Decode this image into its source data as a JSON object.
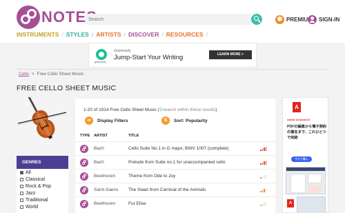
{
  "header": {
    "logo_text": "NOTES",
    "search_placeholder": "Search",
    "premium_label": "PREMIUM",
    "signin_label": "SIGN-IN"
  },
  "nav": {
    "items": [
      {
        "label": "INSTRUMENTS",
        "color": "#c9a227"
      },
      {
        "label": "STYLES",
        "color": "#2fae9b"
      },
      {
        "label": "ARTISTS",
        "color": "#e9732b"
      },
      {
        "label": "DISCOVER",
        "color": "#a64f94"
      },
      {
        "label": "RESOURCES",
        "color": "#e9732b"
      }
    ],
    "separator": "/"
  },
  "ad_banner": {
    "brand": "Grammarly",
    "brand_sub": "grammarly",
    "headline": "Jump-Start Your Writing",
    "cta": "LEARN MORE >"
  },
  "breadcrumb": {
    "link": "Cello",
    "separator": ">",
    "current": "Free Cello Sheet Music"
  },
  "page_title": "FREE CELLO SHEET MUSIC",
  "genres": {
    "heading": "GENRES",
    "items": [
      {
        "label": "All",
        "checked": true
      },
      {
        "label": "Classical",
        "checked": false
      },
      {
        "label": "Rock & Pop",
        "checked": false
      },
      {
        "label": "Jazz",
        "checked": false
      },
      {
        "label": "Traditional",
        "checked": false
      },
      {
        "label": "World",
        "checked": false
      }
    ]
  },
  "results": {
    "summary": "1-20 of 1914 Free Cello Sheet Music",
    "open_paren": " (",
    "search_within": "search within these results",
    "close_paren": ")",
    "display_filters": "Display Filters",
    "sort": "Sort: Popularity"
  },
  "table": {
    "headers": {
      "type": "TYPE",
      "artist": "ARTIST",
      "title": "TITLE"
    },
    "rows": [
      {
        "artist": "Bach",
        "title": "Cello Suite No.1 in G major, BWV 1007 (complete)",
        "difficulty_color": "#e0453a",
        "difficulty_level": 4
      },
      {
        "artist": "Bach",
        "title": "Prelude from Suite no.1 for unaccompanied cello",
        "difficulty_color": "#e0453a",
        "difficulty_level": 4
      },
      {
        "artist": "Beethoven",
        "title": "Theme from Ode to Joy",
        "difficulty_color": "#6cc04a",
        "difficulty_level": 1
      },
      {
        "artist": "Saint-Saens",
        "title": "The Swan from Carnival of the Animals",
        "difficulty_color": "#f08a24",
        "difficulty_level": 3
      },
      {
        "artist": "Beethoven",
        "title": "Fur Elise",
        "difficulty_color": "#f2c230",
        "difficulty_level": 2
      }
    ]
  },
  "side_ad": {
    "logo_letter": "A",
    "title": "Adobe Acrobat DC",
    "text": "PDFの編集から電子契約の署名まで、これひとつで完結",
    "button": "今すぐ購入"
  }
}
